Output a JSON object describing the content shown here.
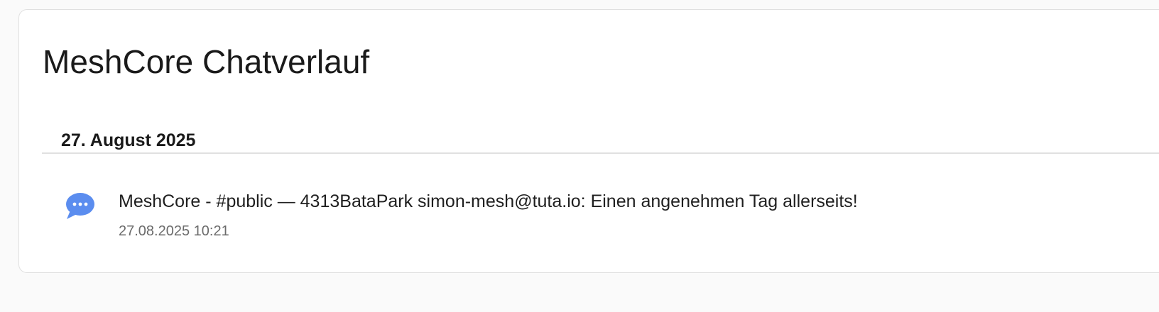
{
  "card": {
    "title": "MeshCore Chatverlauf"
  },
  "groups": [
    {
      "date": "27. August 2025",
      "messages": [
        {
          "icon": "chat-bubble-icon",
          "text": "MeshCore - #public — 4313BataPark simon-mesh@tuta.io: Einen angenehmen Tag allerseits!",
          "time": "27.08.2025 10:21"
        }
      ]
    }
  ],
  "colors": {
    "icon": "#5b8def",
    "background": "#fafafa",
    "card": "#ffffff",
    "divider": "#e0e0e0",
    "secondary_text": "#6b6b6b"
  }
}
